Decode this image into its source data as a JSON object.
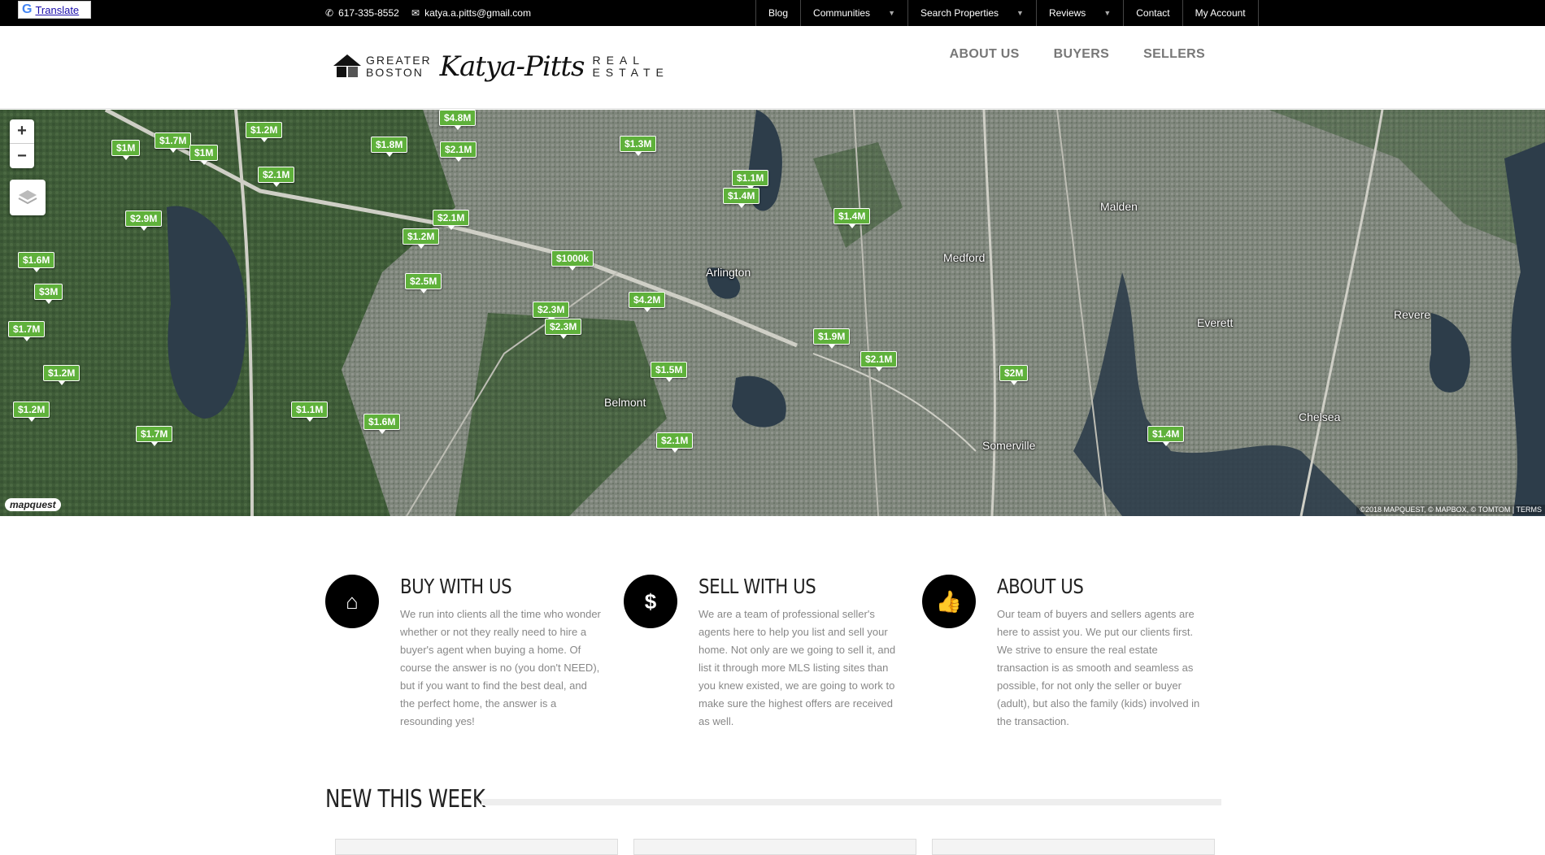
{
  "topbar": {
    "translate_label": "Translate",
    "phone": "617-335-8552",
    "email": "katya.a.pitts@gmail.com",
    "nav": [
      {
        "label": "Blog",
        "dropdown": false
      },
      {
        "label": "Communities",
        "dropdown": true
      },
      {
        "label": "Search Properties",
        "dropdown": true
      },
      {
        "label": "Reviews",
        "dropdown": true
      },
      {
        "label": "Contact",
        "dropdown": false
      },
      {
        "label": "My Account",
        "dropdown": false
      }
    ]
  },
  "logo": {
    "left_top": "GREATER",
    "left_bottom": "BOSTON",
    "script": "Katya-Pitts",
    "right_top": "REAL",
    "right_bottom": "ESTATE"
  },
  "main_nav": [
    "ABOUT US",
    "BUYERS",
    "SELLERS"
  ],
  "map": {
    "zoom_in": "+",
    "zoom_out": "−",
    "provider_logo": "mapquest",
    "attribution": "©2018 MAPQUEST, © MAPBOX, © TOMTOM | TERMS",
    "places": [
      "Arlington",
      "Medford",
      "Malden",
      "Everett",
      "Revere",
      "Somerville",
      "Belmont",
      "Chelsea"
    ],
    "markers": [
      "$1.2M",
      "$1.7M",
      "$1M",
      "$1M",
      "$2.1M",
      "$1.8M",
      "$2.1M",
      "$4.8M",
      "$1.3M",
      "$1.1M",
      "$1.4M",
      "$1.4M",
      "$2.9M",
      "$2.1M",
      "$1.2M",
      "$1000k",
      "$1.6M",
      "$2.5M",
      "$3M",
      "$4.2M",
      "$2.3M",
      "$2.3M",
      "$1.7M",
      "$1.9M",
      "$2.1M",
      "$1.2M",
      "$1.5M",
      "$2M",
      "$1.2M",
      "$1.1M",
      "$1.6M",
      "$1.7M",
      "$2.1M",
      "$1.4M"
    ]
  },
  "features": [
    {
      "title": "BUY WITH US",
      "icon": "home-icon",
      "text": "We run into clients all the time who wonder whether or not they really need to hire a buyer's agent when buying a home. Of course the answer is no (you don't NEED), but if you want to find the best deal, and the perfect home, the answer is a resounding yes!"
    },
    {
      "title": "SELL WITH US",
      "icon": "dollar-icon",
      "text": "We are a team of professional seller's agents here to help you list and sell your home. Not only are we going to sell it, and list it through more MLS listing sites than you knew existed, we are going to work to make sure the highest offers are received as well."
    },
    {
      "title": "ABOUT US",
      "icon": "thumbs-up-icon",
      "text": "Our team of buyers and sellers agents are here to assist you. We put our clients first. We strive to ensure the real estate transaction is as smooth and seamless as possible, for not only the seller or buyer (adult), but also the family (kids) involved in the transaction."
    }
  ],
  "new_this_week": {
    "title": "NEW THIS WEEK"
  },
  "colors": {
    "marker": "#5fb13b",
    "topbar": "#000000",
    "nav_text": "#777777"
  }
}
